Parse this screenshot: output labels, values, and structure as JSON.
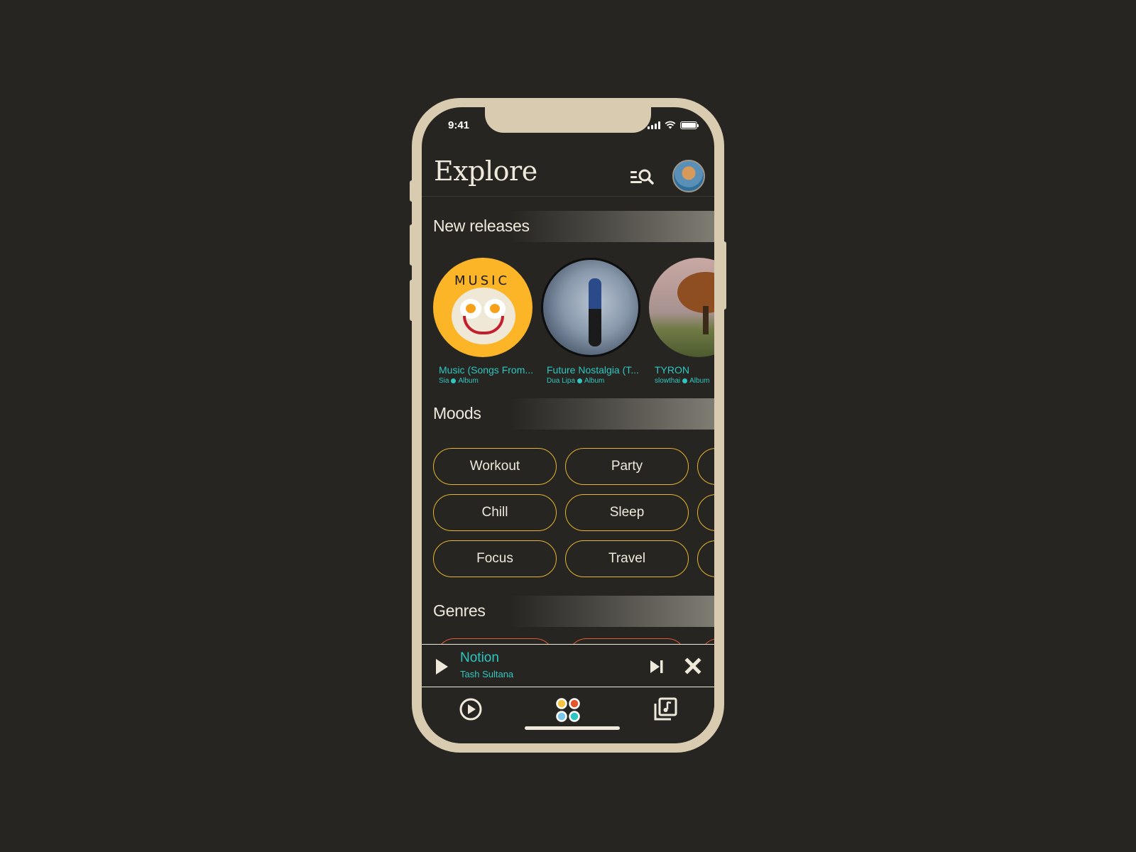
{
  "status_bar": {
    "time": "9:41"
  },
  "header": {
    "title": "Explore",
    "search_icon": "menu-search-icon",
    "avatar_alt": "User profile"
  },
  "sections": {
    "new_releases": "New releases",
    "moods": "Moods",
    "genres": "Genres"
  },
  "new_releases": [
    {
      "title": "Music (Songs From...",
      "artist": "Sia",
      "type": "Album"
    },
    {
      "title": "Future Nostalgia (T...",
      "artist": "Dua Lipa",
      "type": "Album"
    },
    {
      "title": "TYRON",
      "artist": "slowthai",
      "type": "Album"
    }
  ],
  "moods": [
    "Workout",
    "Party",
    "Chill",
    "Sleep",
    "Focus",
    "Travel"
  ],
  "mini_player": {
    "track": "Notion",
    "artist": "Tash Sultana"
  },
  "tabs": [
    {
      "name": "now-playing",
      "icon": "play-circle-icon"
    },
    {
      "name": "explore",
      "icon": "four-dots-icon",
      "active": true
    },
    {
      "name": "library",
      "icon": "music-library-icon"
    }
  ],
  "colors": {
    "background": "#262521",
    "frame": "#d8cbb0",
    "accent_teal": "#2fc6c1",
    "mood_border": "#e5b52f",
    "genre_border": "#e05a35",
    "text": "#efe9dc",
    "dot_yellow": "#f6c443",
    "dot_orange": "#e4562e",
    "dot_blue": "#7cc7ea",
    "dot_teal": "#2fc6c1"
  }
}
